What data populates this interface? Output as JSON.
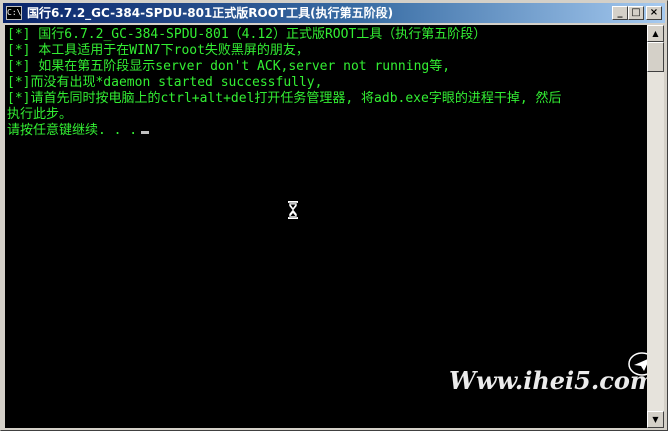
{
  "window": {
    "title": "国行6.7.2_GC-384-SPDU-801正式版ROOT工具(执行第五阶段)",
    "icon_label": "C:\\",
    "controls": {
      "minimize_glyph": "_",
      "maximize_glyph": "□",
      "close_glyph": "×"
    }
  },
  "console": {
    "lines": [
      "[*]  国行6.7.2_GC-384-SPDU-801（4.12）正式版ROOT工具（执行第五阶段）",
      "[*]  本工具适用于在WIN7下root失败黑屏的朋友，",
      "[*]  如果在第五阶段显示server don't ACK,server not running等,",
      "[*]而没有出现*daemon started successfully,",
      "[*]请首先同时按电脑上的ctrl+alt+del打开任务管理器, 将adb.exe字眼的进程干掉, 然后",
      "执行此步。",
      "请按任意键继续. . ."
    ],
    "text_color": "#33ee33",
    "background": "#000000"
  },
  "scrollbar": {
    "up_glyph": "▲",
    "down_glyph": "▼"
  },
  "watermark": {
    "text": "Www.ihei5.com"
  },
  "icons": {
    "title_icon": "console-icon",
    "busy_cursor": "hourglass-icon",
    "watermark_logo": "paper-plane-icon"
  }
}
